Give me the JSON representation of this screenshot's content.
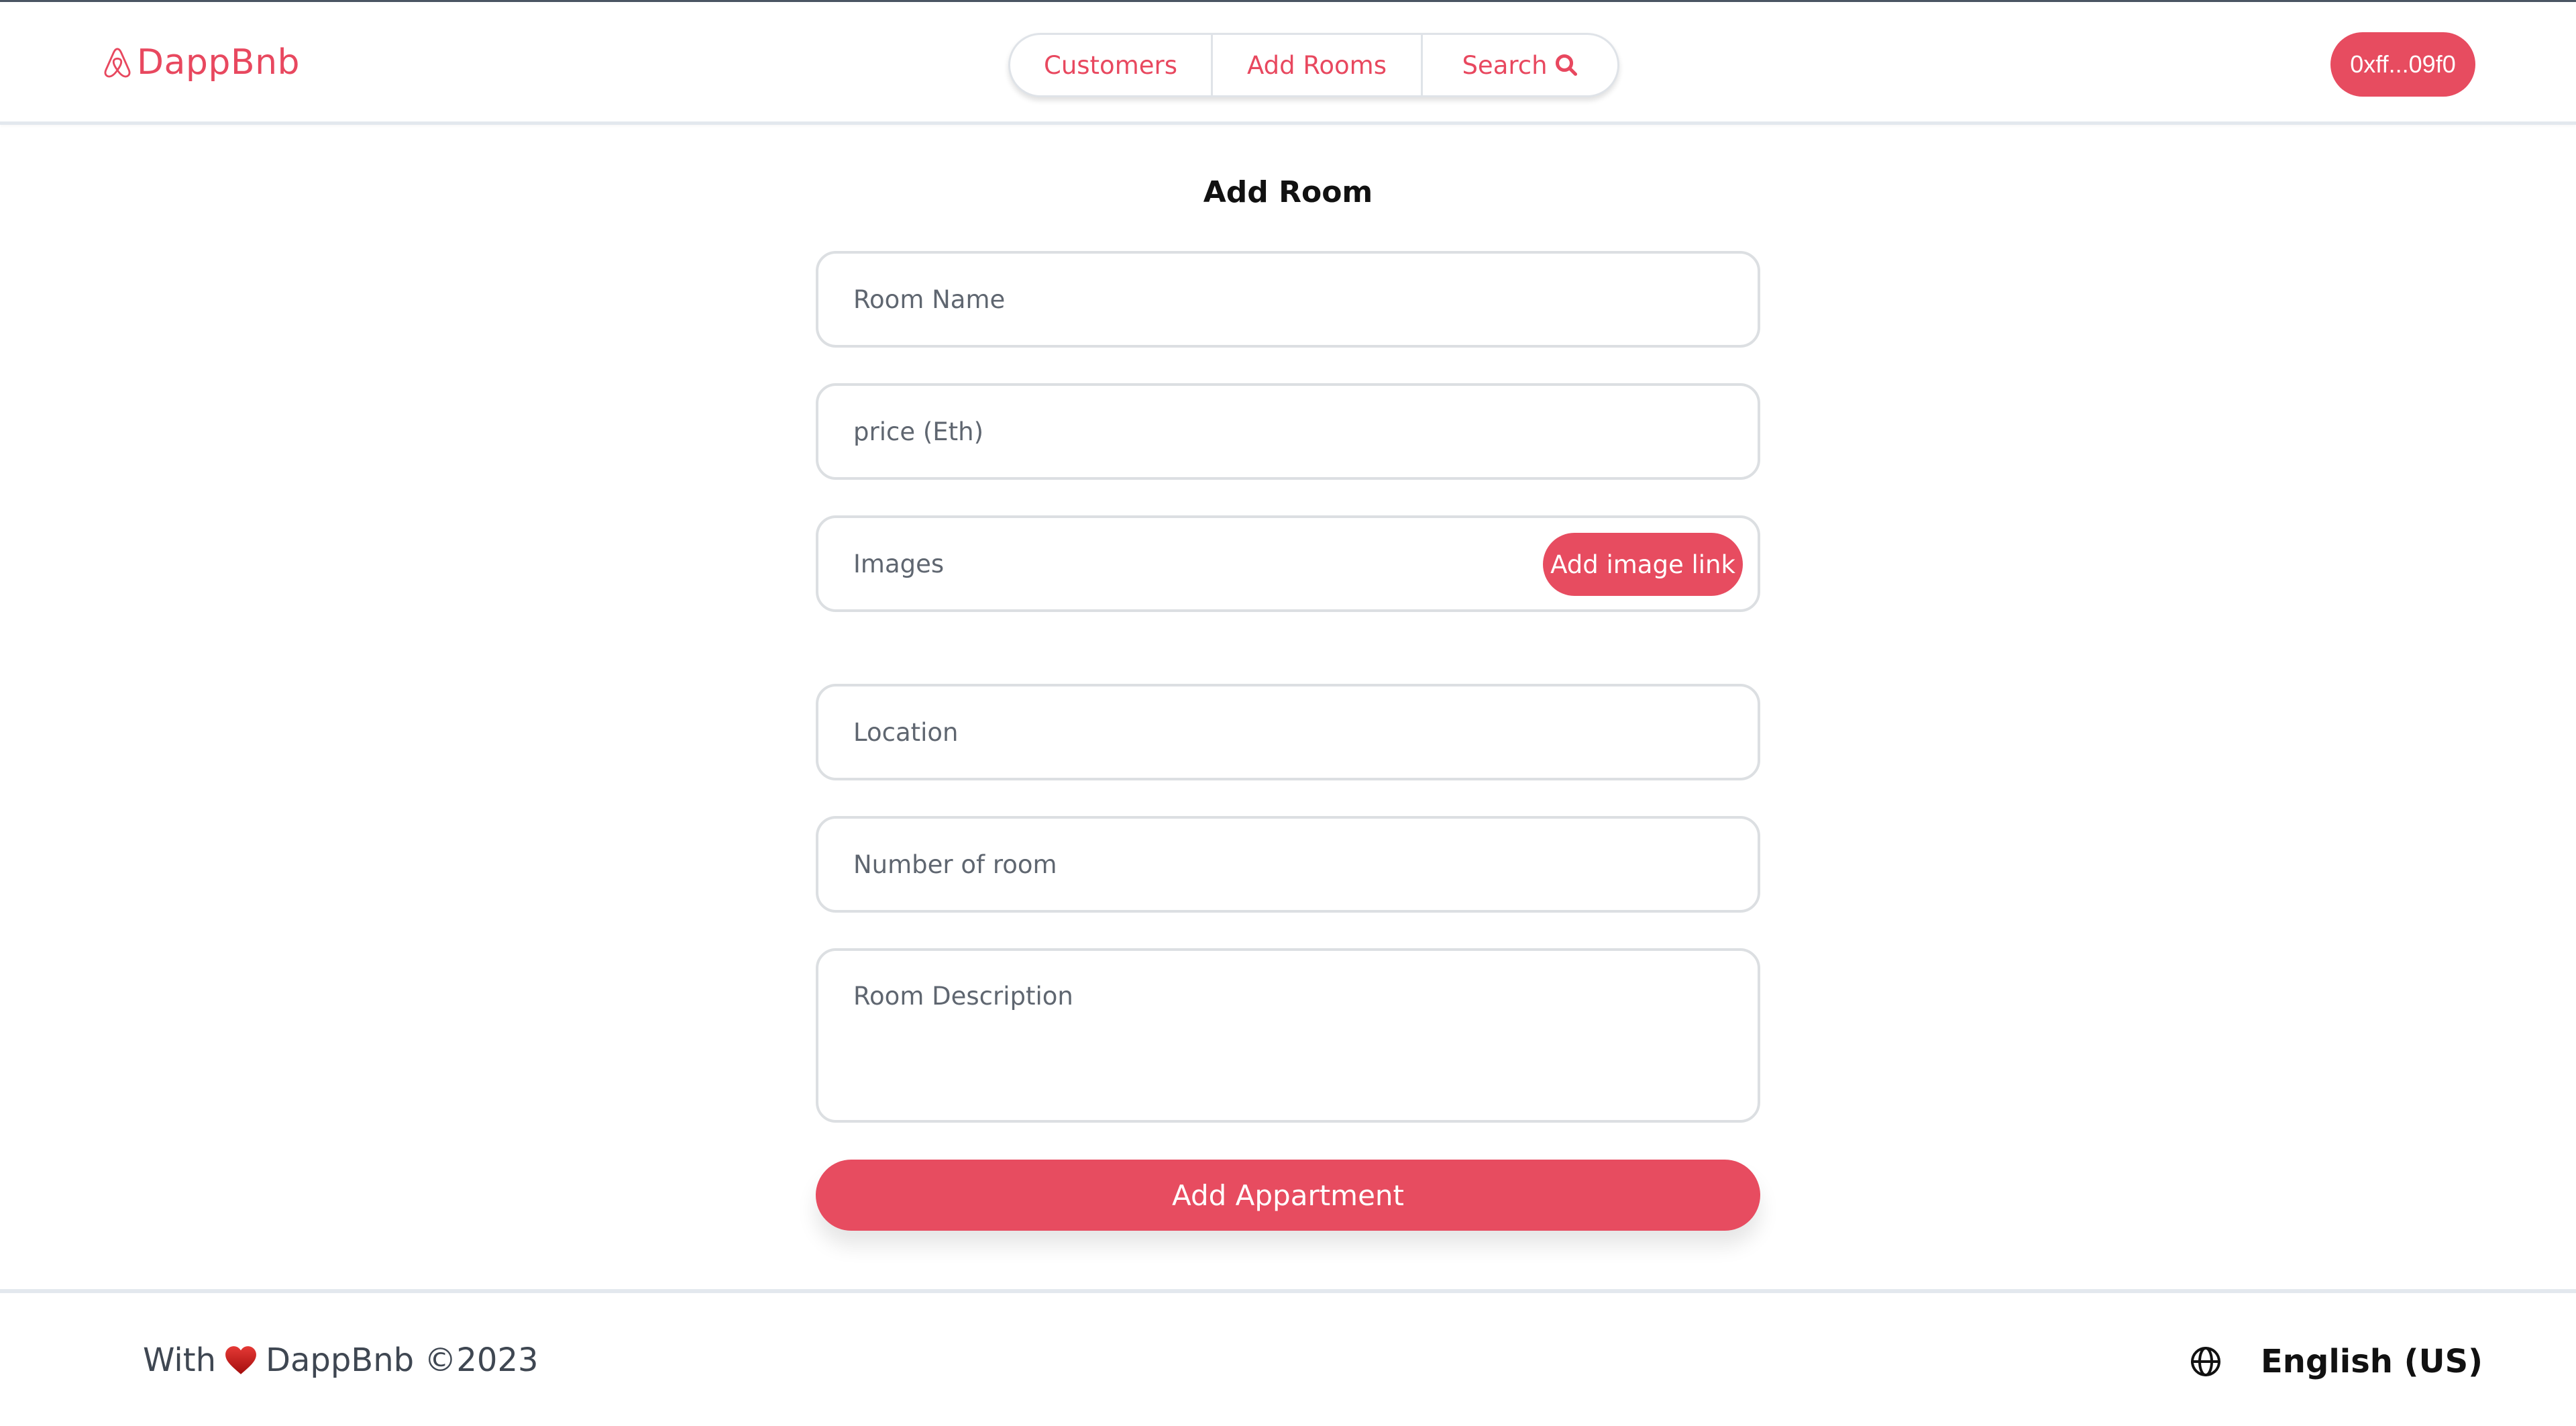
{
  "header": {
    "brand": "DappBnb",
    "brand_icon": "airbnb-logo-icon",
    "nav": [
      {
        "label": "Customers"
      },
      {
        "label": "Add Rooms"
      },
      {
        "label": "Search",
        "icon": "search-icon"
      }
    ],
    "wallet_address": "0xff...09f0"
  },
  "form": {
    "title": "Add Room",
    "fields": {
      "room_name": {
        "placeholder": "Room Name",
        "value": ""
      },
      "price": {
        "placeholder": "price (Eth)",
        "value": ""
      },
      "images": {
        "placeholder": "Images",
        "value": "",
        "button_label": "Add image link"
      },
      "location": {
        "placeholder": "Location",
        "value": ""
      },
      "number_of_room": {
        "placeholder": "Number of room",
        "value": ""
      },
      "room_description": {
        "placeholder": "Room Description",
        "value": ""
      }
    },
    "submit_label": "Add Appartment"
  },
  "footer": {
    "prefix": "With",
    "heart_icon": "heart-icon",
    "copyright": "DappBnb ©2023",
    "language": "English (US)",
    "language_icon": "globe-icon"
  },
  "colors": {
    "accent": "#e74c60",
    "border": "#dcdfe2",
    "text_muted": "#5f6670"
  }
}
